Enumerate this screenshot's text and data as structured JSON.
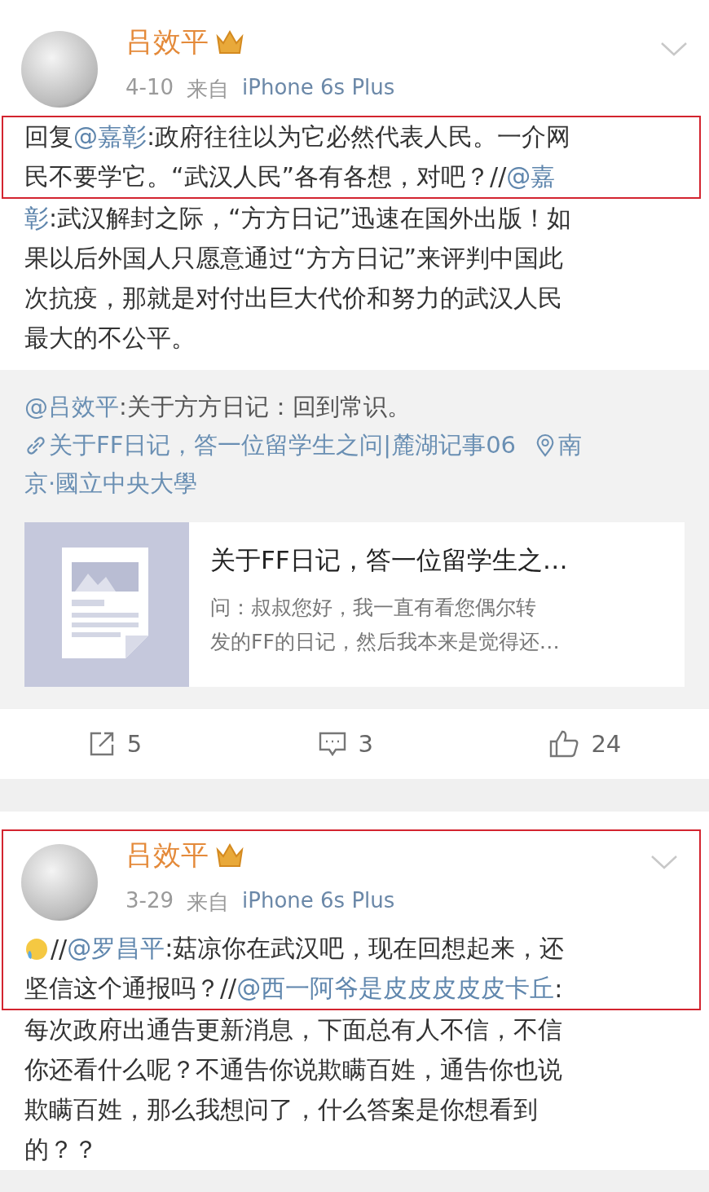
{
  "posts": [
    {
      "author": "吕效平",
      "date": "4-10",
      "source_prefix": "来自",
      "source": "iPhone 6s Plus",
      "header_highlighted": false,
      "lines": [
        {
          "highlighted": true,
          "segments": [
            {
              "kind": "plain",
              "text": "回复"
            },
            {
              "kind": "mention",
              "text": "@嘉彰"
            },
            {
              "kind": "plain",
              "text": ":政府往往以为它必然代表人民。一介网"
            }
          ]
        },
        {
          "highlighted": true,
          "segments": [
            {
              "kind": "plain",
              "text": "民不要学它。“武汉人民”各有各想，对吧？//"
            },
            {
              "kind": "mention",
              "text": "@嘉"
            }
          ]
        },
        {
          "highlighted": false,
          "segments": [
            {
              "kind": "mention",
              "text": "彰"
            },
            {
              "kind": "plain",
              "text": ":武汉解封之际，“方方日记”迅速在国外出版！如"
            }
          ]
        },
        {
          "highlighted": false,
          "segments": [
            {
              "kind": "plain",
              "text": "果以后外国人只愿意通过“方方日记”来评判中国此"
            }
          ]
        },
        {
          "highlighted": false,
          "segments": [
            {
              "kind": "plain",
              "text": "次抗疫，那就是对付出巨大代价和努力的武汉人民"
            }
          ]
        },
        {
          "highlighted": false,
          "segments": [
            {
              "kind": "plain",
              "text": "最大的不公平。"
            }
          ]
        }
      ],
      "repost": {
        "lines": [
          {
            "segments": [
              {
                "kind": "mention",
                "text": "@吕效平"
              },
              {
                "kind": "plain",
                "text": " :关于方方日记：回到常识。"
              }
            ]
          },
          {
            "segments": [
              {
                "kind": "article",
                "text": "关于FF日记，答一位留学生之问|麓湖记事06"
              },
              {
                "kind": "location",
                "text": "南"
              }
            ]
          },
          {
            "segments": [
              {
                "kind": "link",
                "text": "京·國立中央大學"
              }
            ]
          }
        ],
        "card": {
          "title": "关于FF日记，答一位留学生之…",
          "description_lines": [
            "问：叔叔您好，我一直有看您偶尔转",
            "发的FF的日记，然后我本来是觉得还…"
          ]
        }
      },
      "actions": [
        {
          "kind": "share",
          "count": "5"
        },
        {
          "kind": "comment",
          "count": "3"
        },
        {
          "kind": "like",
          "count": "24"
        }
      ]
    },
    {
      "author": "吕效平",
      "date": "3-29",
      "source_prefix": "来自",
      "source": "iPhone 6s Plus",
      "header_highlighted": true,
      "lines": [
        {
          "highlighted": true,
          "segments": [
            {
              "kind": "emoji"
            },
            {
              "kind": "plain",
              "text": "//"
            },
            {
              "kind": "mention",
              "text": "@罗昌平"
            },
            {
              "kind": "plain",
              "text": ":菇凉你在武汉吧，现在回想起来，还"
            }
          ]
        },
        {
          "highlighted": true,
          "segments": [
            {
              "kind": "plain",
              "text": "坚信这个通报吗？//"
            },
            {
              "kind": "mention",
              "text": "@西一阿爷是皮皮皮皮皮卡丘"
            },
            {
              "kind": "plain",
              "text": ":"
            }
          ]
        },
        {
          "highlighted": false,
          "segments": [
            {
              "kind": "plain",
              "text": "每次政府出通告更新消息，下面总有人不信，不信"
            }
          ]
        },
        {
          "highlighted": false,
          "segments": [
            {
              "kind": "plain",
              "text": "你还看什么呢？不通告你说欺瞒百姓，通告你也说"
            }
          ]
        },
        {
          "highlighted": false,
          "segments": [
            {
              "kind": "plain",
              "text": "欺瞒百姓，那么我想问了，什么答案是你想看到"
            }
          ]
        },
        {
          "highlighted": false,
          "segments": [
            {
              "kind": "plain",
              "text": "的？？"
            }
          ]
        }
      ]
    }
  ]
}
